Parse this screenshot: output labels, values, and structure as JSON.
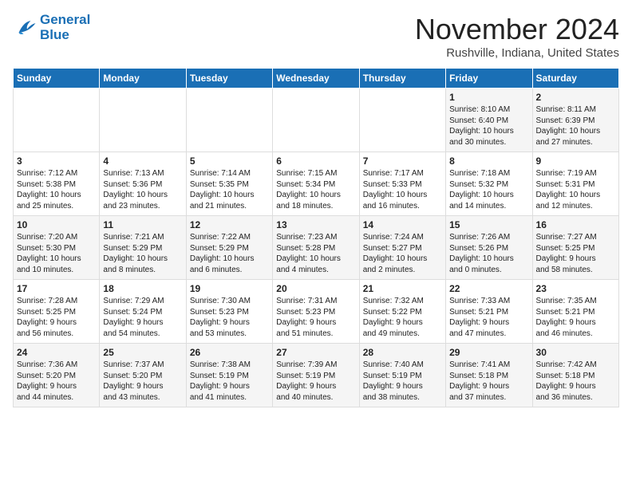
{
  "header": {
    "logo_line1": "General",
    "logo_line2": "Blue",
    "month": "November 2024",
    "location": "Rushville, Indiana, United States"
  },
  "weekdays": [
    "Sunday",
    "Monday",
    "Tuesday",
    "Wednesday",
    "Thursday",
    "Friday",
    "Saturday"
  ],
  "weeks": [
    [
      {
        "day": "",
        "detail": ""
      },
      {
        "day": "",
        "detail": ""
      },
      {
        "day": "",
        "detail": ""
      },
      {
        "day": "",
        "detail": ""
      },
      {
        "day": "",
        "detail": ""
      },
      {
        "day": "1",
        "detail": "Sunrise: 8:10 AM\nSunset: 6:40 PM\nDaylight: 10 hours\nand 30 minutes."
      },
      {
        "day": "2",
        "detail": "Sunrise: 8:11 AM\nSunset: 6:39 PM\nDaylight: 10 hours\nand 27 minutes."
      }
    ],
    [
      {
        "day": "3",
        "detail": "Sunrise: 7:12 AM\nSunset: 5:38 PM\nDaylight: 10 hours\nand 25 minutes."
      },
      {
        "day": "4",
        "detail": "Sunrise: 7:13 AM\nSunset: 5:36 PM\nDaylight: 10 hours\nand 23 minutes."
      },
      {
        "day": "5",
        "detail": "Sunrise: 7:14 AM\nSunset: 5:35 PM\nDaylight: 10 hours\nand 21 minutes."
      },
      {
        "day": "6",
        "detail": "Sunrise: 7:15 AM\nSunset: 5:34 PM\nDaylight: 10 hours\nand 18 minutes."
      },
      {
        "day": "7",
        "detail": "Sunrise: 7:17 AM\nSunset: 5:33 PM\nDaylight: 10 hours\nand 16 minutes."
      },
      {
        "day": "8",
        "detail": "Sunrise: 7:18 AM\nSunset: 5:32 PM\nDaylight: 10 hours\nand 14 minutes."
      },
      {
        "day": "9",
        "detail": "Sunrise: 7:19 AM\nSunset: 5:31 PM\nDaylight: 10 hours\nand 12 minutes."
      }
    ],
    [
      {
        "day": "10",
        "detail": "Sunrise: 7:20 AM\nSunset: 5:30 PM\nDaylight: 10 hours\nand 10 minutes."
      },
      {
        "day": "11",
        "detail": "Sunrise: 7:21 AM\nSunset: 5:29 PM\nDaylight: 10 hours\nand 8 minutes."
      },
      {
        "day": "12",
        "detail": "Sunrise: 7:22 AM\nSunset: 5:29 PM\nDaylight: 10 hours\nand 6 minutes."
      },
      {
        "day": "13",
        "detail": "Sunrise: 7:23 AM\nSunset: 5:28 PM\nDaylight: 10 hours\nand 4 minutes."
      },
      {
        "day": "14",
        "detail": "Sunrise: 7:24 AM\nSunset: 5:27 PM\nDaylight: 10 hours\nand 2 minutes."
      },
      {
        "day": "15",
        "detail": "Sunrise: 7:26 AM\nSunset: 5:26 PM\nDaylight: 10 hours\nand 0 minutes."
      },
      {
        "day": "16",
        "detail": "Sunrise: 7:27 AM\nSunset: 5:25 PM\nDaylight: 9 hours\nand 58 minutes."
      }
    ],
    [
      {
        "day": "17",
        "detail": "Sunrise: 7:28 AM\nSunset: 5:25 PM\nDaylight: 9 hours\nand 56 minutes."
      },
      {
        "day": "18",
        "detail": "Sunrise: 7:29 AM\nSunset: 5:24 PM\nDaylight: 9 hours\nand 54 minutes."
      },
      {
        "day": "19",
        "detail": "Sunrise: 7:30 AM\nSunset: 5:23 PM\nDaylight: 9 hours\nand 53 minutes."
      },
      {
        "day": "20",
        "detail": "Sunrise: 7:31 AM\nSunset: 5:23 PM\nDaylight: 9 hours\nand 51 minutes."
      },
      {
        "day": "21",
        "detail": "Sunrise: 7:32 AM\nSunset: 5:22 PM\nDaylight: 9 hours\nand 49 minutes."
      },
      {
        "day": "22",
        "detail": "Sunrise: 7:33 AM\nSunset: 5:21 PM\nDaylight: 9 hours\nand 47 minutes."
      },
      {
        "day": "23",
        "detail": "Sunrise: 7:35 AM\nSunset: 5:21 PM\nDaylight: 9 hours\nand 46 minutes."
      }
    ],
    [
      {
        "day": "24",
        "detail": "Sunrise: 7:36 AM\nSunset: 5:20 PM\nDaylight: 9 hours\nand 44 minutes."
      },
      {
        "day": "25",
        "detail": "Sunrise: 7:37 AM\nSunset: 5:20 PM\nDaylight: 9 hours\nand 43 minutes."
      },
      {
        "day": "26",
        "detail": "Sunrise: 7:38 AM\nSunset: 5:19 PM\nDaylight: 9 hours\nand 41 minutes."
      },
      {
        "day": "27",
        "detail": "Sunrise: 7:39 AM\nSunset: 5:19 PM\nDaylight: 9 hours\nand 40 minutes."
      },
      {
        "day": "28",
        "detail": "Sunrise: 7:40 AM\nSunset: 5:19 PM\nDaylight: 9 hours\nand 38 minutes."
      },
      {
        "day": "29",
        "detail": "Sunrise: 7:41 AM\nSunset: 5:18 PM\nDaylight: 9 hours\nand 37 minutes."
      },
      {
        "day": "30",
        "detail": "Sunrise: 7:42 AM\nSunset: 5:18 PM\nDaylight: 9 hours\nand 36 minutes."
      }
    ]
  ]
}
